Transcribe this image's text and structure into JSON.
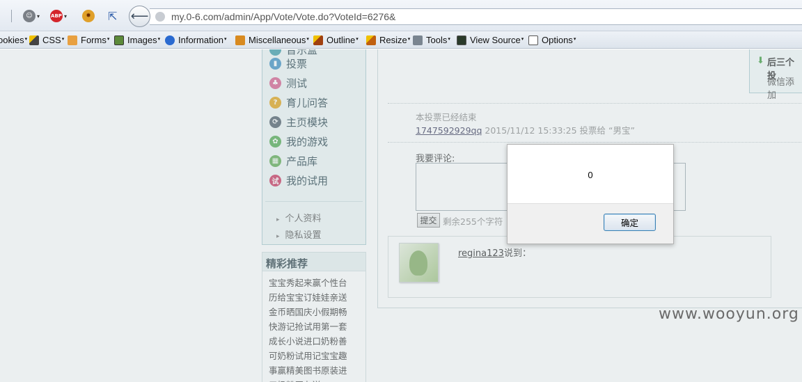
{
  "browser": {
    "url": "my.0-6.com/admin/App/Vote/Vote.do?VoteId=6276&",
    "back_icon": "back-arrow-icon",
    "toolbar_icons": [
      "menu-icon",
      "greasemonkey-icon",
      "adblock-icon",
      "firebug-icon",
      "inspect-icon"
    ],
    "adblock_label": "ABP"
  },
  "bookmarks": [
    {
      "label": "ookies",
      "icon": "cookie-icon"
    },
    {
      "label": "CSS",
      "icon": "css-pencil-icon"
    },
    {
      "label": "Forms",
      "icon": "forms-icon"
    },
    {
      "label": "Images",
      "icon": "images-icon"
    },
    {
      "label": "Information",
      "icon": "info-icon"
    },
    {
      "label": "Miscellaneous",
      "icon": "misc-icon"
    },
    {
      "label": "Outline",
      "icon": "outline-pencil-icon"
    },
    {
      "label": "Resize",
      "icon": "resize-icon"
    },
    {
      "label": "Tools",
      "icon": "tools-icon"
    },
    {
      "label": "View Source",
      "icon": "view-source-icon"
    },
    {
      "label": "Options",
      "icon": "options-icon"
    }
  ],
  "sidebar": {
    "items": [
      {
        "label": "音乐盒",
        "icon": "music-icon",
        "color": "#3a9aa8"
      },
      {
        "label": "投票",
        "icon": "chart-icon",
        "color": "#3b8ec2"
      },
      {
        "label": "测试",
        "icon": "test-icon",
        "color": "#d65a8a"
      },
      {
        "label": "育儿问答",
        "icon": "question-icon",
        "color": "#e0a010"
      },
      {
        "label": "主页模块",
        "icon": "module-icon",
        "color": "#4a5a66"
      },
      {
        "label": "我的游戏",
        "icon": "game-icon",
        "color": "#4da84d"
      },
      {
        "label": "产品库",
        "icon": "product-icon",
        "color": "#5aa84d"
      },
      {
        "label": "我的试用",
        "icon": "trial-icon",
        "color": "#c8315a",
        "glyph": "试"
      }
    ],
    "sub_items": [
      "个人资料",
      "隐私设置"
    ]
  },
  "recommend": {
    "title": "精彩推荐",
    "text": "宝宝秀起来赢个性台历给宝宝订娃娃亲送金币晒国庆小假期畅快游记抢试用第一套成长小说进口奶粉善可奶粉试用记宝宝趣事赢精美图书原装进口奶粉买九送二"
  },
  "tips": {
    "line1": "后三个投",
    "line2": "微信添加"
  },
  "vote": {
    "ended": "本投票已经结束",
    "voter": "1747592929qq",
    "detail": " 2015/11/12 15:33:25 投票给 “男宝”"
  },
  "comment": {
    "label": "我要评论:",
    "submit": "提交",
    "remaining": "剩余255个字符",
    "commenter": "regina123",
    "said": "说到："
  },
  "dialog": {
    "message": "0",
    "ok": "确定"
  },
  "watermark": "www.wooyun.org"
}
